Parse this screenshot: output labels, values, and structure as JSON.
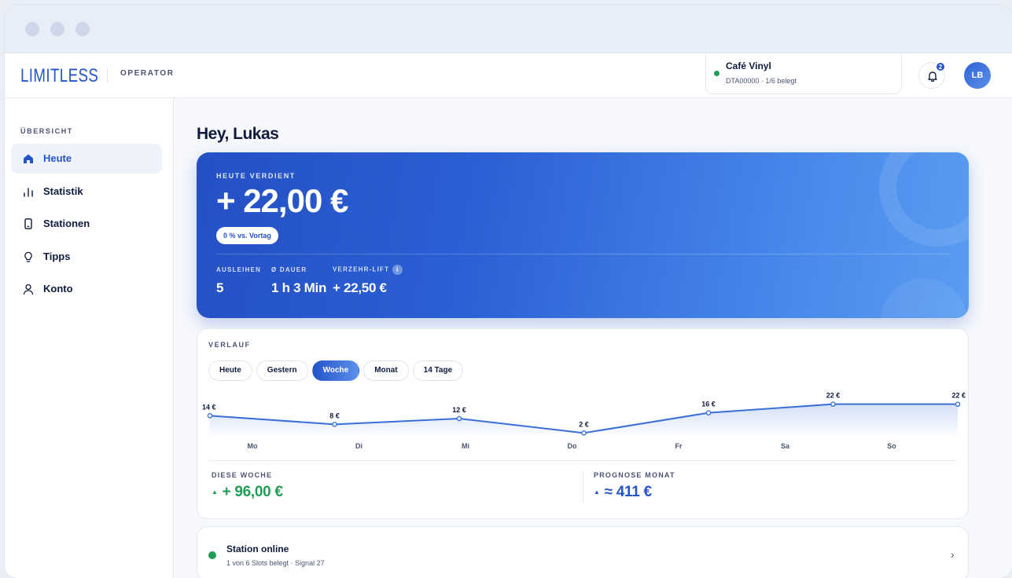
{
  "brand": {
    "logo": "LIMITLESS",
    "section": "OPERATOR"
  },
  "location": {
    "name": "Café Vinyl",
    "status_line": "DTA00000 · 1/6 belegt",
    "status_color": "#1f9d55"
  },
  "notifications": {
    "count": "2",
    "icon": "bell-icon"
  },
  "user": {
    "initials": "LB"
  },
  "sidebar": {
    "heading": "ÜBERSICHT",
    "items": [
      {
        "label": "Heute",
        "icon": "home-icon",
        "active": true
      },
      {
        "label": "Statistik",
        "icon": "bar-chart-icon"
      },
      {
        "label": "Stationen",
        "icon": "device-icon"
      },
      {
        "label": "Tipps",
        "icon": "lightbulb-icon"
      },
      {
        "label": "Konto",
        "icon": "user-icon"
      }
    ]
  },
  "greeting": "Hey, Lukas",
  "earnings": {
    "label": "HEUTE VERDIENT",
    "amount": "+ 22,00 €",
    "change": "0 % vs. Vortag",
    "stats": [
      {
        "label": "AUSLEIHEN",
        "value": "5"
      },
      {
        "label": "Ø DAUER",
        "value": "1 h 3 Min"
      },
      {
        "label": "VERZEHR-LIFT",
        "value": "+ 22,50 €",
        "info_icon": "i"
      }
    ]
  },
  "history": {
    "heading": "VERLAUF",
    "tabs": [
      "Heute",
      "Gestern",
      "Woche",
      "Monat",
      "14 Tage"
    ],
    "active_tab": "Woche",
    "week_label": "DIESE WOCHE",
    "week_value": "+ 96,00 €",
    "forecast_label": "PROGNOSE MONAT",
    "forecast_value": "≈ 411 €"
  },
  "chart_data": {
    "type": "area",
    "categories": [
      "Mo",
      "Di",
      "Mi",
      "Do",
      "Fr",
      "Sa",
      "So"
    ],
    "values": [
      14,
      8,
      12,
      2,
      16,
      22,
      22
    ],
    "data_labels": [
      "14 €",
      "8 €",
      "12 €",
      "2 €",
      "16 €",
      "22 €",
      "22 €"
    ],
    "ylim": [
      0,
      24
    ],
    "grid": false,
    "color": "#3a6fd8"
  },
  "station": {
    "title": "Station online",
    "subtitle": "1 von 6 Slots belegt · Signal 27",
    "status_color": "#1f9d55",
    "chevron": "›"
  }
}
